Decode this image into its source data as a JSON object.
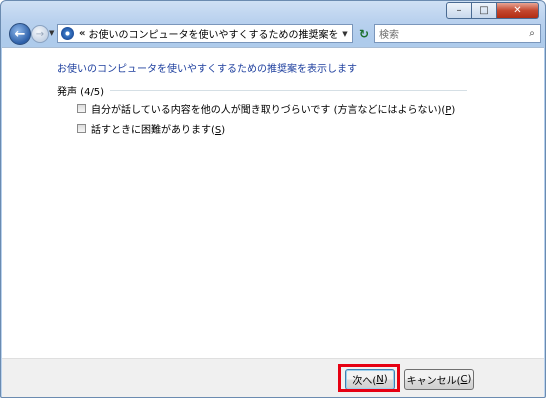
{
  "window": {
    "caption_buttons": {
      "minimize": "–",
      "maximize": "□",
      "close": "✕"
    },
    "highlight_color": "#e60012"
  },
  "nav": {
    "back_glyph": "←",
    "forward_glyph": "→",
    "history_glyph": "▼",
    "address_chevron": "«",
    "address_text": "お使いのコンピュータを使いやすくするための推奨案を...",
    "address_drop_glyph": "▼",
    "refresh_glyph": "↻",
    "search_placeholder": "検索",
    "search_glyph": "⌕"
  },
  "main": {
    "heading": "お使いのコンピュータを使いやすくするための推奨案を表示します",
    "group_title": "発声 (4/5)",
    "options": [
      {
        "text": "自分が話している内容を他の人が聞き取りづらいです (方言などにはよらない)(",
        "accel": "P",
        "close": ")",
        "checked": false
      },
      {
        "text": "話すときに困難があります(",
        "accel": "S",
        "close": ")",
        "checked": false
      }
    ]
  },
  "footer": {
    "next_text": "次へ(",
    "next_accel": "N",
    "next_close": ")",
    "cancel_text": "キャンセル(",
    "cancel_accel": "C",
    "cancel_close": ")"
  }
}
